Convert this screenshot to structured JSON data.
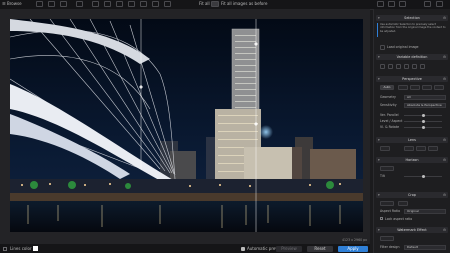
{
  "topbar": {
    "menu_label": "Browse",
    "fit_label": "Fit all",
    "zoom_mode": "fit",
    "compare_label": "Fit all images as before"
  },
  "panel": {
    "selection": {
      "title": "Selection",
      "text": "Use automatic Selection to precisely select information from the original image the content to be adjusted.",
      "load_label": "Load original image"
    },
    "mask": {
      "title": "Variable definition"
    },
    "perspective": {
      "title": "Perspective",
      "mode_label": "Auto",
      "method_label": "Geometry",
      "method_value": "All",
      "mode2_label": "Sensitivity",
      "mode2_value": "Absolute & Perspective",
      "rows": [
        {
          "label": "Ver. Parallel"
        },
        {
          "label": "Level / Aspect"
        },
        {
          "label": "Vl. & Rotate"
        }
      ]
    },
    "lens": {
      "title": "Lens"
    },
    "horizon": {
      "title": "Horizon",
      "rows": [
        {
          "label": "Tilt"
        }
      ]
    },
    "crop": {
      "title": "Crop",
      "aspect_label": "Aspect Ratio",
      "aspect_value": "Original",
      "checkbox_label": "Lock aspect ratio"
    },
    "watermark": {
      "title": "Watermark Effect",
      "filter_label": "Filter design",
      "filter_value": "Default"
    }
  },
  "bottombar": {
    "lines_label": "Lines color",
    "line_color": "#ffffff",
    "coords": "4123 x 2960 px",
    "auto_preview_label": "Automatic preview",
    "preview_label": "Preview",
    "reset_label": "Reset",
    "apply_label": "Apply"
  },
  "colors": {
    "accent": "#2f7fd6",
    "panel_bg": "#1e1e20",
    "guide": "#ffffff"
  }
}
